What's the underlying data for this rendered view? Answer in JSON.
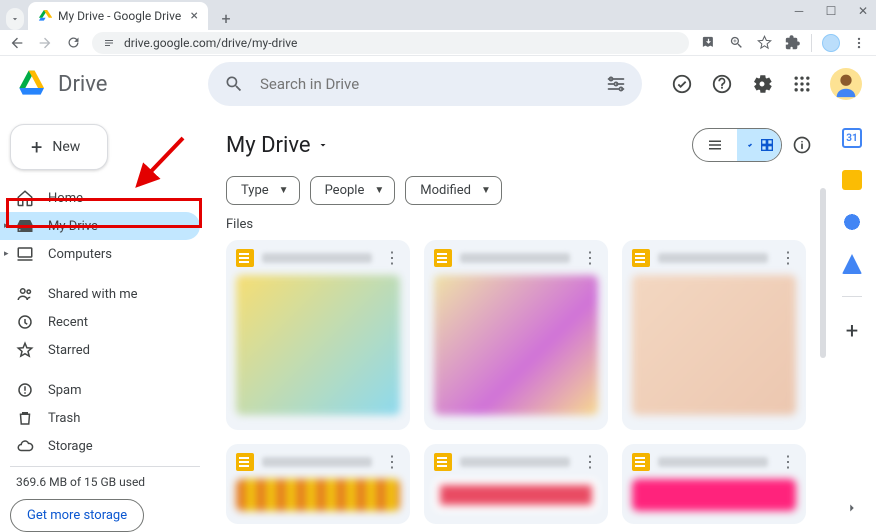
{
  "browser": {
    "tab_title": "My Drive - Google Drive",
    "url": "drive.google.com/drive/my-drive"
  },
  "app": {
    "name": "Drive",
    "search_placeholder": "Search in Drive"
  },
  "new_button": "New",
  "nav": {
    "home": "Home",
    "mydrive": "My Drive",
    "computers": "Computers",
    "shared": "Shared with me",
    "recent": "Recent",
    "starred": "Starred",
    "spam": "Spam",
    "trash": "Trash",
    "storage": "Storage"
  },
  "storage": {
    "usage": "369.6 MB of 15 GB used",
    "cta": "Get more storage"
  },
  "main": {
    "breadcrumb": "My Drive",
    "filters": {
      "type": "Type",
      "people": "People",
      "modified": "Modified"
    },
    "section": "Files"
  }
}
